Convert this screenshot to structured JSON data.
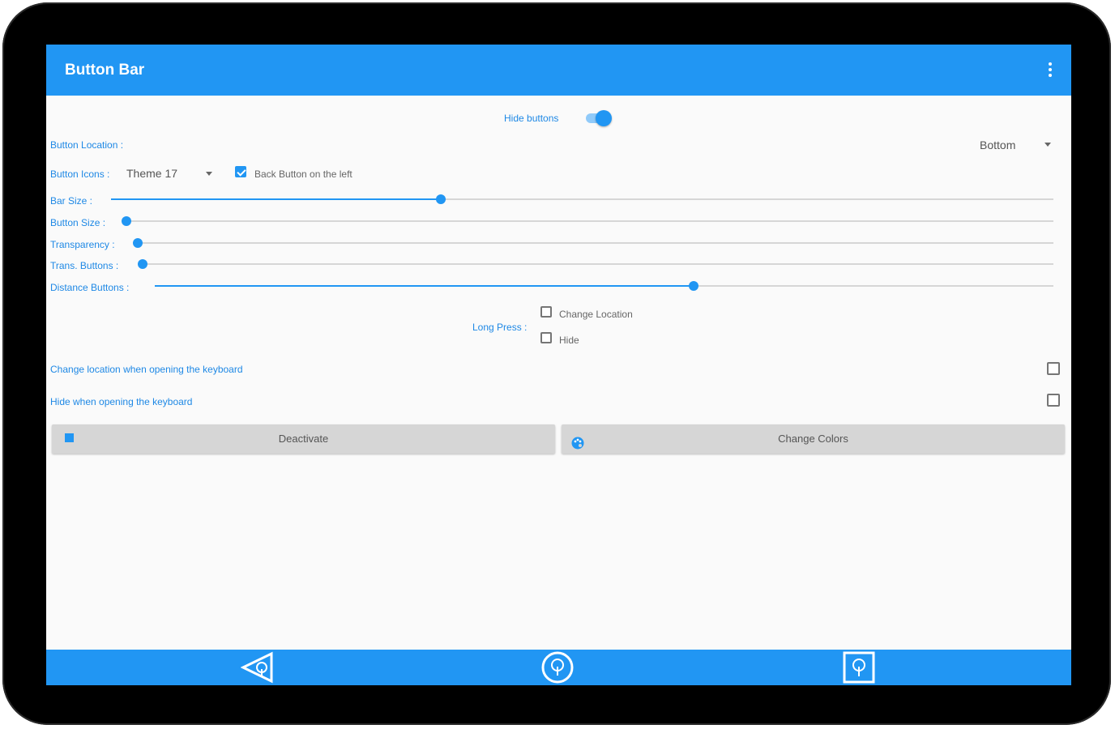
{
  "app": {
    "title": "Button Bar"
  },
  "hide_buttons": {
    "label": "Hide buttons",
    "on": true
  },
  "button_location": {
    "label": "Button Location :",
    "selected": "Bottom"
  },
  "button_icons": {
    "label": "Button Icons :",
    "selected": "Theme 17"
  },
  "back_left": {
    "label": "Back Button on the left",
    "checked": true
  },
  "sliders": [
    {
      "label": "Bar Size :",
      "value": 0.35
    },
    {
      "label": "Button Size :",
      "value": 0.0
    },
    {
      "label": "Transparency :",
      "value": 0.0
    },
    {
      "label": "Trans. Buttons :",
      "value": 0.0
    },
    {
      "label": "Distance Buttons :",
      "value": 0.6
    }
  ],
  "long_press": {
    "label": "Long Press :",
    "options": [
      {
        "label": "Change Location",
        "checked": false
      },
      {
        "label": "Hide",
        "checked": false
      }
    ]
  },
  "keyboard_options": [
    {
      "label": "Change location when opening the keyboard",
      "checked": false
    },
    {
      "label": "Hide when opening the keyboard",
      "checked": false
    }
  ],
  "buttons": {
    "deactivate": "Deactivate",
    "change_colors": "Change Colors"
  },
  "colors": {
    "accent": "#2196f3",
    "label": "#1e88e5",
    "bar": "#2196f3"
  },
  "icons": {
    "overflow": "overflow-menu-icon",
    "deactivate": "stop-icon",
    "colors": "palette-icon",
    "nav_back": "back-triangle-icon",
    "nav_home": "home-circle-icon",
    "nav_recent": "recent-square-icon"
  }
}
